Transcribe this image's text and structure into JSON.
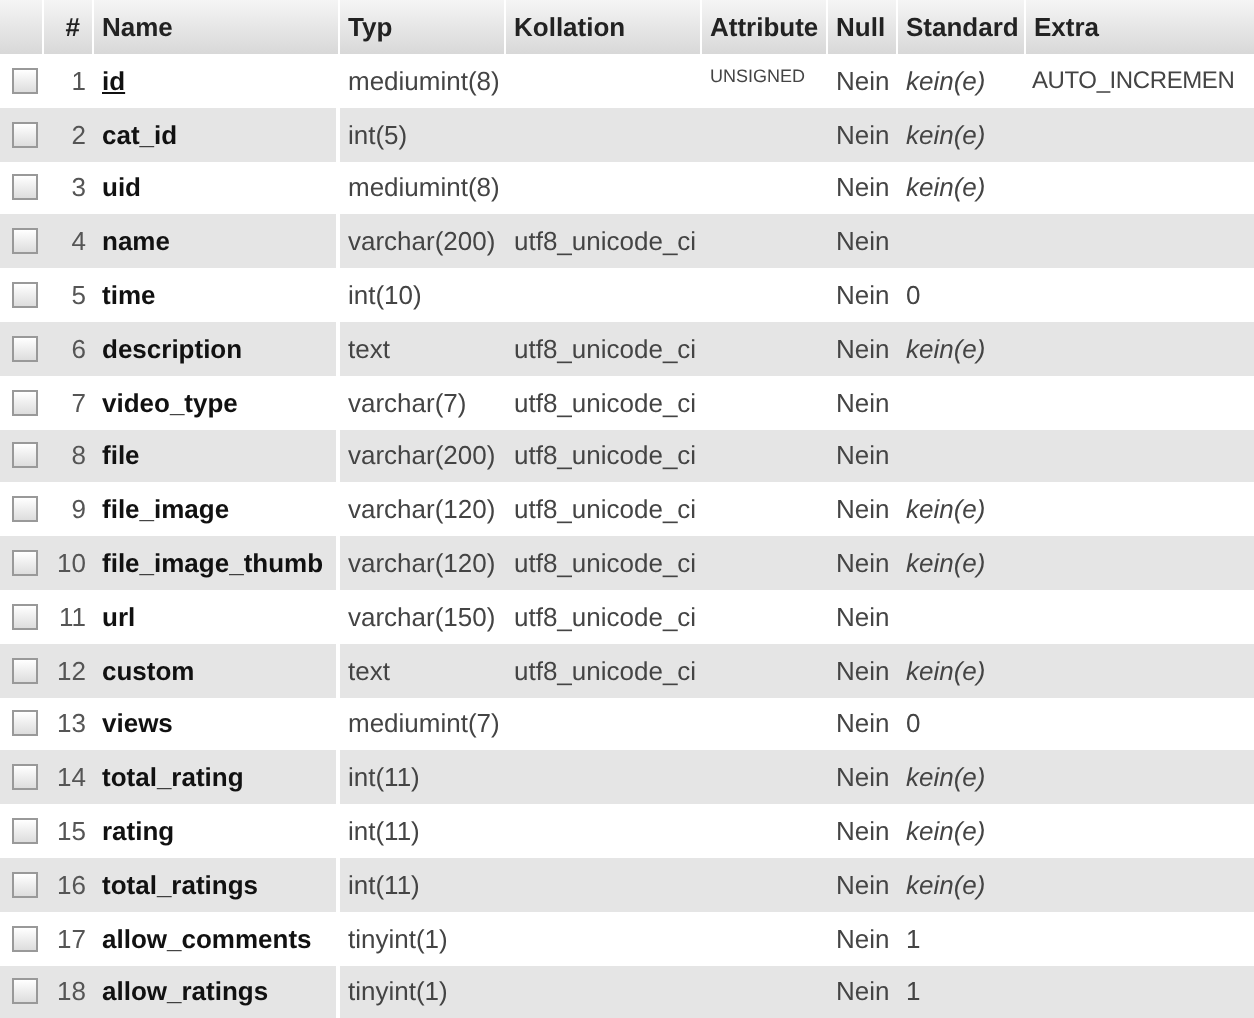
{
  "columns": [
    "#",
    "Name",
    "Typ",
    "Kollation",
    "Attribute",
    "Null",
    "Standard",
    "Extra"
  ],
  "rows": [
    {
      "num": "1",
      "name": "id",
      "primary": true,
      "type": "mediumint(8)",
      "attribute": "UNSIGNED",
      "null": "Nein",
      "standard": {
        "text": "kein(e)",
        "none": true
      },
      "extra": "AUTO_INCREMEN",
      "checked": false
    },
    {
      "num": "2",
      "name": "cat_id",
      "primary": false,
      "type": "int(5)",
      "null": "Nein",
      "standard": {
        "text": "kein(e)",
        "none": true
      },
      "checked": false
    },
    {
      "num": "3",
      "name": "uid",
      "primary": false,
      "type": "mediumint(8)",
      "null": "Nein",
      "standard": {
        "text": "kein(e)",
        "none": true
      },
      "checked": false
    },
    {
      "num": "4",
      "name": "name",
      "primary": false,
      "type": "varchar(200)",
      "collation": "utf8_unicode_ci",
      "null": "Nein",
      "checked": false
    },
    {
      "num": "5",
      "name": "time",
      "primary": false,
      "type": "int(10)",
      "null": "Nein",
      "standard": {
        "text": "0",
        "none": false
      },
      "checked": false
    },
    {
      "num": "6",
      "name": "description",
      "primary": false,
      "type": "text",
      "collation": "utf8_unicode_ci",
      "null": "Nein",
      "standard": {
        "text": "kein(e)",
        "none": true
      },
      "checked": false
    },
    {
      "num": "7",
      "name": "video_type",
      "primary": false,
      "type": "varchar(7)",
      "collation": "utf8_unicode_ci",
      "null": "Nein",
      "checked": false
    },
    {
      "num": "8",
      "name": "file",
      "primary": false,
      "type": "varchar(200)",
      "collation": "utf8_unicode_ci",
      "null": "Nein",
      "checked": false
    },
    {
      "num": "9",
      "name": "file_image",
      "primary": false,
      "type": "varchar(120)",
      "collation": "utf8_unicode_ci",
      "null": "Nein",
      "standard": {
        "text": "kein(e)",
        "none": true
      },
      "checked": false
    },
    {
      "num": "10",
      "name": "file_image_thumb",
      "primary": false,
      "type": "varchar(120)",
      "collation": "utf8_unicode_ci",
      "null": "Nein",
      "standard": {
        "text": "kein(e)",
        "none": true
      },
      "checked": false
    },
    {
      "num": "11",
      "name": "url",
      "primary": false,
      "type": "varchar(150)",
      "collation": "utf8_unicode_ci",
      "null": "Nein",
      "checked": false
    },
    {
      "num": "12",
      "name": "custom",
      "primary": false,
      "type": "text",
      "collation": "utf8_unicode_ci",
      "null": "Nein",
      "standard": {
        "text": "kein(e)",
        "none": true
      },
      "checked": false
    },
    {
      "num": "13",
      "name": "views",
      "primary": false,
      "type": "mediumint(7)",
      "null": "Nein",
      "standard": {
        "text": "0",
        "none": false
      },
      "checked": false
    },
    {
      "num": "14",
      "name": "total_rating",
      "primary": false,
      "type": "int(11)",
      "null": "Nein",
      "standard": {
        "text": "kein(e)",
        "none": true
      },
      "checked": false
    },
    {
      "num": "15",
      "name": "rating",
      "primary": false,
      "type": "int(11)",
      "null": "Nein",
      "standard": {
        "text": "kein(e)",
        "none": true
      },
      "checked": false
    },
    {
      "num": "16",
      "name": "total_ratings",
      "primary": false,
      "type": "int(11)",
      "null": "Nein",
      "standard": {
        "text": "kein(e)",
        "none": true
      },
      "checked": false
    },
    {
      "num": "17",
      "name": "allow_comments",
      "primary": false,
      "type": "tinyint(1)",
      "null": "Nein",
      "standard": {
        "text": "1",
        "none": false
      },
      "checked": false
    },
    {
      "num": "18",
      "name": "allow_ratings",
      "primary": false,
      "type": "tinyint(1)",
      "null": "Nein",
      "standard": {
        "text": "1",
        "none": false
      },
      "checked": false
    }
  ]
}
